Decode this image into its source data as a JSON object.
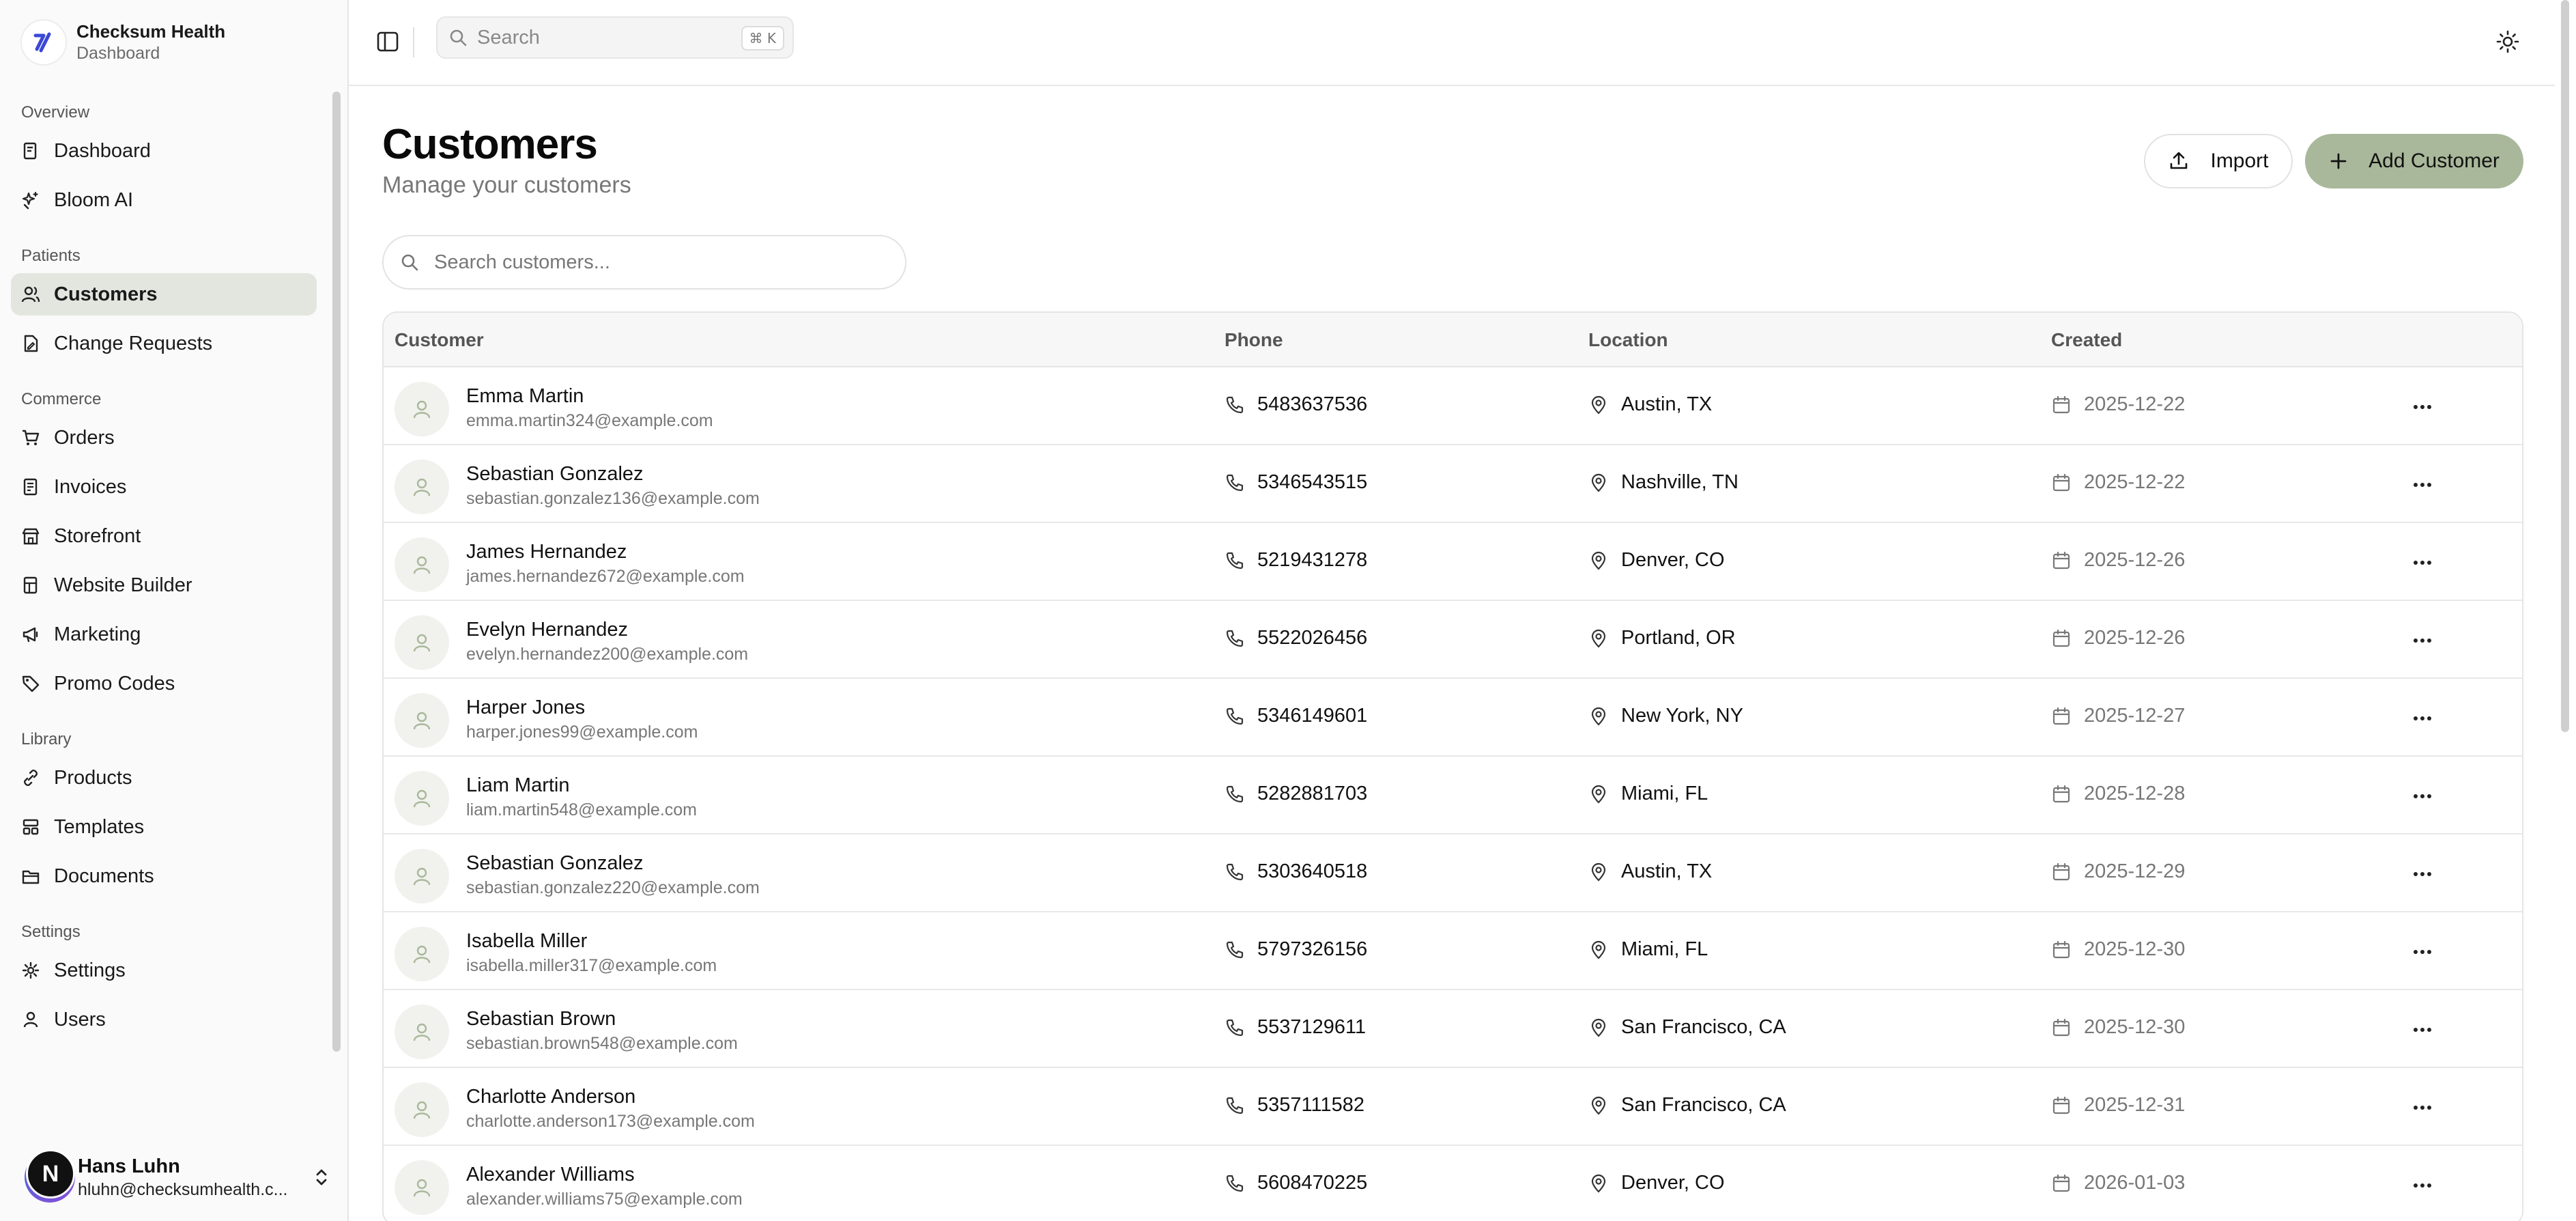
{
  "brand": {
    "name": "Checksum Health",
    "subtitle": "Dashboard"
  },
  "sidebar": {
    "groups": [
      {
        "label": "Overview",
        "items": [
          {
            "label": "Dashboard",
            "icon": "dashboard-icon"
          },
          {
            "label": "Bloom AI",
            "icon": "sparkles-icon"
          }
        ]
      },
      {
        "label": "Patients",
        "items": [
          {
            "label": "Customers",
            "icon": "users-icon",
            "active": true
          },
          {
            "label": "Change Requests",
            "icon": "file-edit-icon"
          }
        ]
      },
      {
        "label": "Commerce",
        "items": [
          {
            "label": "Orders",
            "icon": "cart-icon"
          },
          {
            "label": "Invoices",
            "icon": "invoice-icon"
          },
          {
            "label": "Storefront",
            "icon": "store-icon"
          },
          {
            "label": "Website Builder",
            "icon": "layout-icon"
          },
          {
            "label": "Marketing",
            "icon": "megaphone-icon"
          },
          {
            "label": "Promo Codes",
            "icon": "tag-icon"
          }
        ]
      },
      {
        "label": "Library",
        "items": [
          {
            "label": "Products",
            "icon": "link-icon"
          },
          {
            "label": "Templates",
            "icon": "template-icon"
          },
          {
            "label": "Documents",
            "icon": "folder-icon"
          }
        ]
      },
      {
        "label": "Settings",
        "items": [
          {
            "label": "Settings",
            "icon": "gear-icon"
          },
          {
            "label": "Users",
            "icon": "user-icon"
          }
        ]
      }
    ]
  },
  "user": {
    "initial": "N",
    "name": "Hans Luhn",
    "email": "hluhn@checksumhealth.c..."
  },
  "topbar": {
    "search_placeholder": "Search",
    "shortcut": "⌘ K"
  },
  "page": {
    "title": "Customers",
    "subtitle": "Manage your customers",
    "import_label": "Import",
    "add_label": "Add Customer",
    "search_placeholder": "Search customers..."
  },
  "table": {
    "columns": {
      "customer": "Customer",
      "phone": "Phone",
      "location": "Location",
      "created": "Created"
    },
    "rows": [
      {
        "name": "Emma Martin",
        "email": "emma.martin324@example.com",
        "phone": "5483637536",
        "location": "Austin, TX",
        "created": "2025-12-22"
      },
      {
        "name": "Sebastian Gonzalez",
        "email": "sebastian.gonzalez136@example.com",
        "phone": "5346543515",
        "location": "Nashville, TN",
        "created": "2025-12-22"
      },
      {
        "name": "James Hernandez",
        "email": "james.hernandez672@example.com",
        "phone": "5219431278",
        "location": "Denver, CO",
        "created": "2025-12-26"
      },
      {
        "name": "Evelyn Hernandez",
        "email": "evelyn.hernandez200@example.com",
        "phone": "5522026456",
        "location": "Portland, OR",
        "created": "2025-12-26"
      },
      {
        "name": "Harper Jones",
        "email": "harper.jones99@example.com",
        "phone": "5346149601",
        "location": "New York, NY",
        "created": "2025-12-27"
      },
      {
        "name": "Liam Martin",
        "email": "liam.martin548@example.com",
        "phone": "5282881703",
        "location": "Miami, FL",
        "created": "2025-12-28"
      },
      {
        "name": "Sebastian Gonzalez",
        "email": "sebastian.gonzalez220@example.com",
        "phone": "5303640518",
        "location": "Austin, TX",
        "created": "2025-12-29"
      },
      {
        "name": "Isabella Miller",
        "email": "isabella.miller317@example.com",
        "phone": "5797326156",
        "location": "Miami, FL",
        "created": "2025-12-30"
      },
      {
        "name": "Sebastian Brown",
        "email": "sebastian.brown548@example.com",
        "phone": "5537129611",
        "location": "San Francisco, CA",
        "created": "2025-12-30"
      },
      {
        "name": "Charlotte Anderson",
        "email": "charlotte.anderson173@example.com",
        "phone": "5357111582",
        "location": "San Francisco, CA",
        "created": "2025-12-31"
      },
      {
        "name": "Alexander Williams",
        "email": "alexander.williams75@example.com",
        "phone": "5608470225",
        "location": "Denver, CO",
        "created": "2026-01-03"
      }
    ]
  },
  "colors": {
    "accent": "#a9b89a",
    "active_nav": "#e3e6df",
    "logo_blue": "#3b48d6"
  }
}
